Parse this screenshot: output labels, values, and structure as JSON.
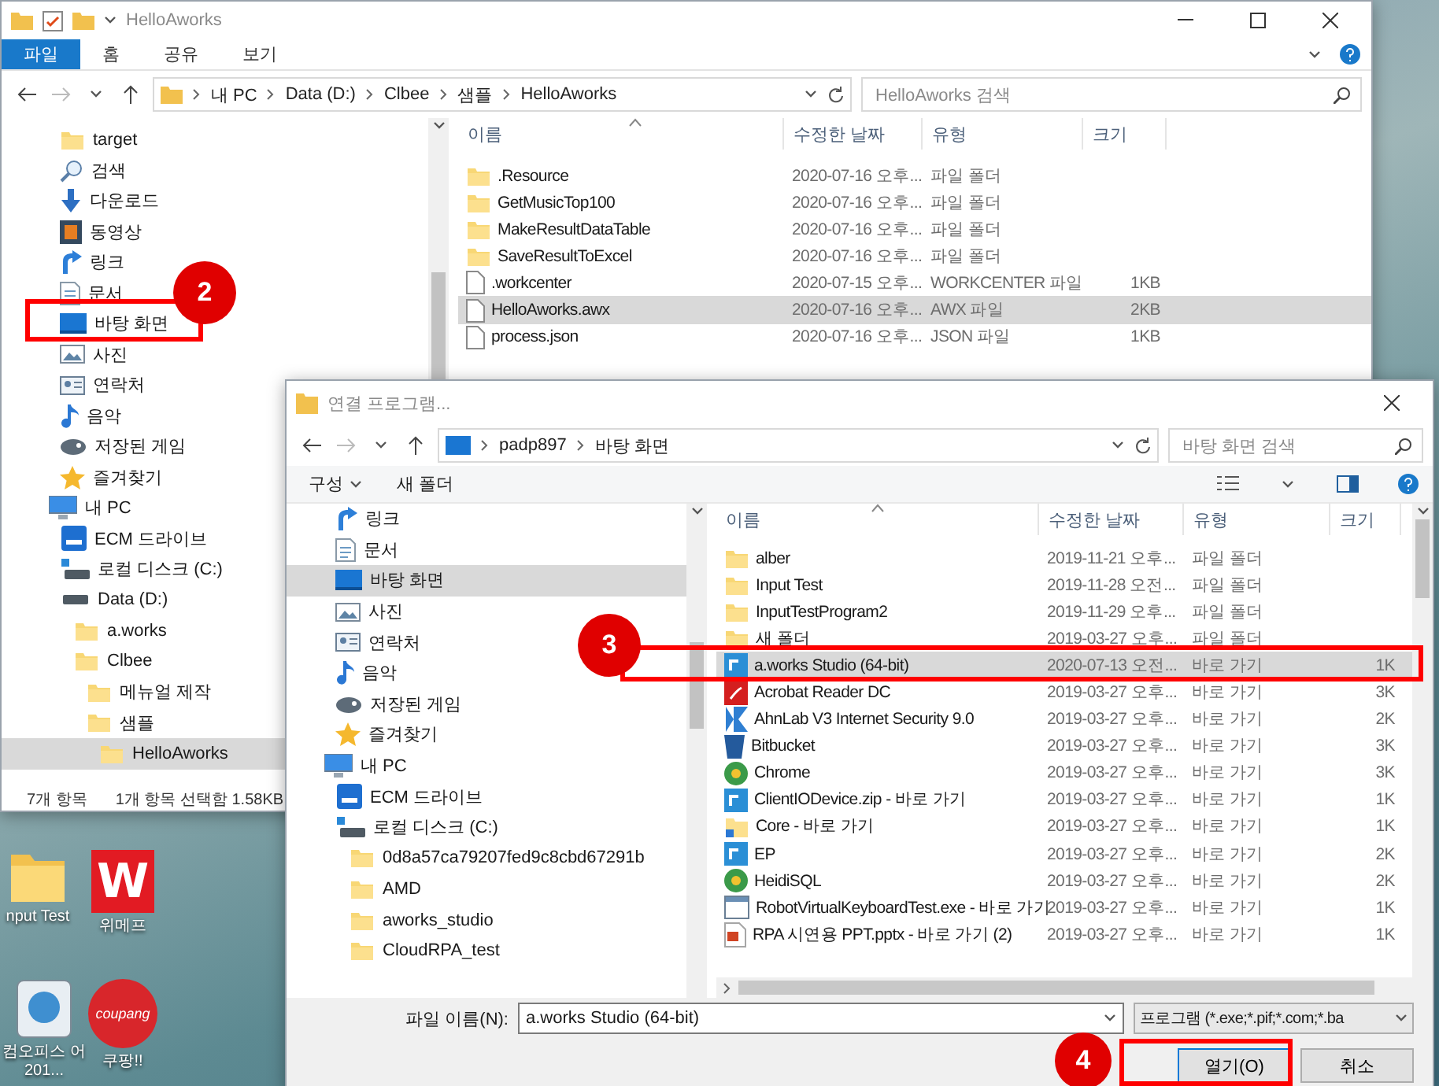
{
  "desktop": {
    "icons": [
      {
        "label": "nput Test",
        "kind": "folder"
      },
      {
        "label": "위메프",
        "kind": "logo",
        "logo_text": "W"
      },
      {
        "label": "컴오피스 어 201...",
        "kind": "app"
      },
      {
        "label": "쿠팡!!",
        "kind": "seal",
        "logo_text": "coupang"
      }
    ]
  },
  "explorer": {
    "title": "HelloAworks",
    "ribbon_tabs": [
      {
        "label": "파일",
        "selected": true
      },
      {
        "label": "홈",
        "selected": false
      },
      {
        "label": "공유",
        "selected": false
      },
      {
        "label": "보기",
        "selected": false
      }
    ],
    "address": [
      "내 PC",
      "Data (D:)",
      "Clbee",
      "샘플",
      "HelloAworks"
    ],
    "search": {
      "placeholder": "HelloAworks 검색"
    },
    "nav": [
      {
        "label": "target",
        "kind": "folder",
        "selected": false
      },
      {
        "label": "검색",
        "kind": "search",
        "selected": false
      },
      {
        "label": "다운로드",
        "kind": "download",
        "selected": false
      },
      {
        "label": "동영상",
        "kind": "video",
        "selected": false
      },
      {
        "label": "링크",
        "kind": "link",
        "selected": false
      },
      {
        "label": "문서",
        "kind": "document",
        "selected": false
      },
      {
        "label": "바탕 화면",
        "kind": "desktop",
        "selected": false
      },
      {
        "label": "사진",
        "kind": "picture",
        "selected": false
      },
      {
        "label": "연락처",
        "kind": "contact",
        "selected": false
      },
      {
        "label": "음악",
        "kind": "music",
        "selected": false
      },
      {
        "label": "저장된 게임",
        "kind": "game",
        "selected": false
      },
      {
        "label": "즐겨찾기",
        "kind": "star",
        "selected": false
      },
      {
        "label": "내 PC",
        "kind": "computer",
        "selected": false,
        "children": [
          {
            "label": "ECM 드라이브",
            "kind": "ecm",
            "selected": false
          },
          {
            "label": "로컬 디스크 (C:)",
            "kind": "system-disk",
            "selected": false
          },
          {
            "label": "Data (D:)",
            "kind": "disk",
            "selected": false,
            "children": [
              {
                "label": "a.works",
                "kind": "folder",
                "selected": false
              },
              {
                "label": "Clbee",
                "kind": "folder",
                "selected": false,
                "children": [
                  {
                    "label": "메뉴얼 제작",
                    "kind": "folder",
                    "selected": false
                  },
                  {
                    "label": "샘플",
                    "kind": "folder",
                    "selected": false,
                    "children": [
                      {
                        "label": "HelloAworks",
                        "kind": "folder",
                        "selected": true
                      }
                    ]
                  }
                ]
              }
            ]
          }
        ]
      }
    ],
    "columns": [
      "이름",
      "수정한 날짜",
      "유형",
      "크기"
    ],
    "rows": [
      {
        "name": ".Resource",
        "date": "2020-07-16 오후...",
        "type": "파일 폴더",
        "size": "",
        "kind": "folder",
        "selected": false
      },
      {
        "name": "GetMusicTop100",
        "date": "2020-07-16 오후...",
        "type": "파일 폴더",
        "size": "",
        "kind": "folder",
        "selected": false
      },
      {
        "name": "MakeResultDataTable",
        "date": "2020-07-16 오후...",
        "type": "파일 폴더",
        "size": "",
        "kind": "folder",
        "selected": false
      },
      {
        "name": "SaveResultToExcel",
        "date": "2020-07-16 오후...",
        "type": "파일 폴더",
        "size": "",
        "kind": "folder",
        "selected": false
      },
      {
        "name": ".workcenter",
        "date": "2020-07-15 오후...",
        "type": "WORKCENTER 파일",
        "size": "1KB",
        "kind": "file",
        "selected": false
      },
      {
        "name": "HelloAworks.awx",
        "date": "2020-07-16 오후...",
        "type": "AWX 파일",
        "size": "2KB",
        "kind": "file",
        "selected": true
      },
      {
        "name": "process.json",
        "date": "2020-07-16 오후...",
        "type": "JSON 파일",
        "size": "1KB",
        "kind": "file",
        "selected": false
      }
    ],
    "status_bar": {
      "count": "7개 항목",
      "selection": "1개 항목 선택함 1.58KB"
    }
  },
  "dialog": {
    "title": "연결 프로그램...",
    "address": [
      "padp897",
      "바탕 화면"
    ],
    "search": {
      "placeholder": "바탕 화면 검색"
    },
    "toolbar": [
      "구성",
      "새 폴더"
    ],
    "nav": [
      {
        "label": "링크",
        "kind": "link",
        "selected": false
      },
      {
        "label": "문서",
        "kind": "document",
        "selected": false
      },
      {
        "label": "바탕 화면",
        "kind": "desktop",
        "selected": true
      },
      {
        "label": "사진",
        "kind": "picture",
        "selected": false
      },
      {
        "label": "연락처",
        "kind": "contact",
        "selected": false
      },
      {
        "label": "음악",
        "kind": "music",
        "selected": false
      },
      {
        "label": "저장된 게임",
        "kind": "game",
        "selected": false
      },
      {
        "label": "즐겨찾기",
        "kind": "star",
        "selected": false
      },
      {
        "label": "내 PC",
        "kind": "computer",
        "selected": false,
        "children": [
          {
            "label": "ECM 드라이브",
            "kind": "ecm",
            "selected": false
          },
          {
            "label": "로컬 디스크 (C:)",
            "kind": "system-disk",
            "selected": false,
            "children": [
              {
                "label": "0d8a57ca79207fed9c8cbd67291b",
                "kind": "folder",
                "selected": false
              },
              {
                "label": "AMD",
                "kind": "folder",
                "selected": false
              },
              {
                "label": "aworks_studio",
                "kind": "folder",
                "selected": false
              },
              {
                "label": "CloudRPA_test",
                "kind": "folder",
                "selected": false
              }
            ]
          }
        ]
      }
    ],
    "columns": [
      "이름",
      "수정한 날짜",
      "유형",
      "크기"
    ],
    "rows": [
      {
        "name": "alber",
        "date": "2019-11-21 오후...",
        "type": "파일 폴더",
        "size": "",
        "kind": "folder",
        "selected": false
      },
      {
        "name": "Input Test",
        "date": "2019-11-28 오전...",
        "type": "파일 폴더",
        "size": "",
        "kind": "folder",
        "selected": false
      },
      {
        "name": "InputTestProgram2",
        "date": "2019-11-29 오후...",
        "type": "파일 폴더",
        "size": "",
        "kind": "folder",
        "selected": false
      },
      {
        "name": "새 폴더",
        "date": "2019-03-27 오후...",
        "type": "파일 폴더",
        "size": "",
        "kind": "folder",
        "selected": false
      },
      {
        "name": "a.works Studio (64-bit)",
        "date": "2020-07-13 오전...",
        "type": "바로 가기",
        "size": "1K",
        "kind": "app",
        "selected": true
      },
      {
        "name": "Acrobat Reader DC",
        "date": "2019-03-27 오후...",
        "type": "바로 가기",
        "size": "3K",
        "kind": "pdf",
        "selected": false
      },
      {
        "name": "AhnLab V3 Internet Security 9.0",
        "date": "2019-03-27 오후...",
        "type": "바로 가기",
        "size": "2K",
        "kind": "shield",
        "selected": false
      },
      {
        "name": "Bitbucket",
        "date": "2019-03-27 오후...",
        "type": "바로 가기",
        "size": "3K",
        "kind": "bucket",
        "selected": false
      },
      {
        "name": "Chrome",
        "date": "2019-03-27 오후...",
        "type": "바로 가기",
        "size": "3K",
        "kind": "ball",
        "selected": false
      },
      {
        "name": "ClientIODevice.zip - 바로 가기",
        "date": "2019-03-27 오후...",
        "type": "바로 가기",
        "size": "1K",
        "kind": "app",
        "selected": false
      },
      {
        "name": "Core - 바로 가기",
        "date": "2019-03-27 오후...",
        "type": "바로 가기",
        "size": "1K",
        "kind": "folder-shortcut",
        "selected": false
      },
      {
        "name": "EP",
        "date": "2019-03-27 오후...",
        "type": "바로 가기",
        "size": "2K",
        "kind": "app",
        "selected": false
      },
      {
        "name": "HeidiSQL",
        "date": "2019-03-27 오후...",
        "type": "바로 가기",
        "size": "2K",
        "kind": "ball",
        "selected": false
      },
      {
        "name": "RobotVirtualKeyboardTest.exe - 바로 가기",
        "date": "2019-03-27 오후...",
        "type": "바로 가기",
        "size": "1K",
        "kind": "window-shortcut",
        "selected": false
      },
      {
        "name": "RPA 시연용 PPT.pptx - 바로 가기 (2)",
        "date": "2019-03-27 오후...",
        "type": "바로 가기",
        "size": "1K",
        "kind": "slides",
        "selected": false
      }
    ],
    "file_name": {
      "label": "파일 이름(N):",
      "value": "a.works Studio (64-bit)"
    },
    "file_type": "프로그램 (*.exe;*.pif;*.com;*.ba",
    "buttons": [
      "열기(O)",
      "취소"
    ]
  },
  "annotations": [
    {
      "label": "2"
    },
    {
      "label": "3"
    },
    {
      "label": "4"
    }
  ]
}
